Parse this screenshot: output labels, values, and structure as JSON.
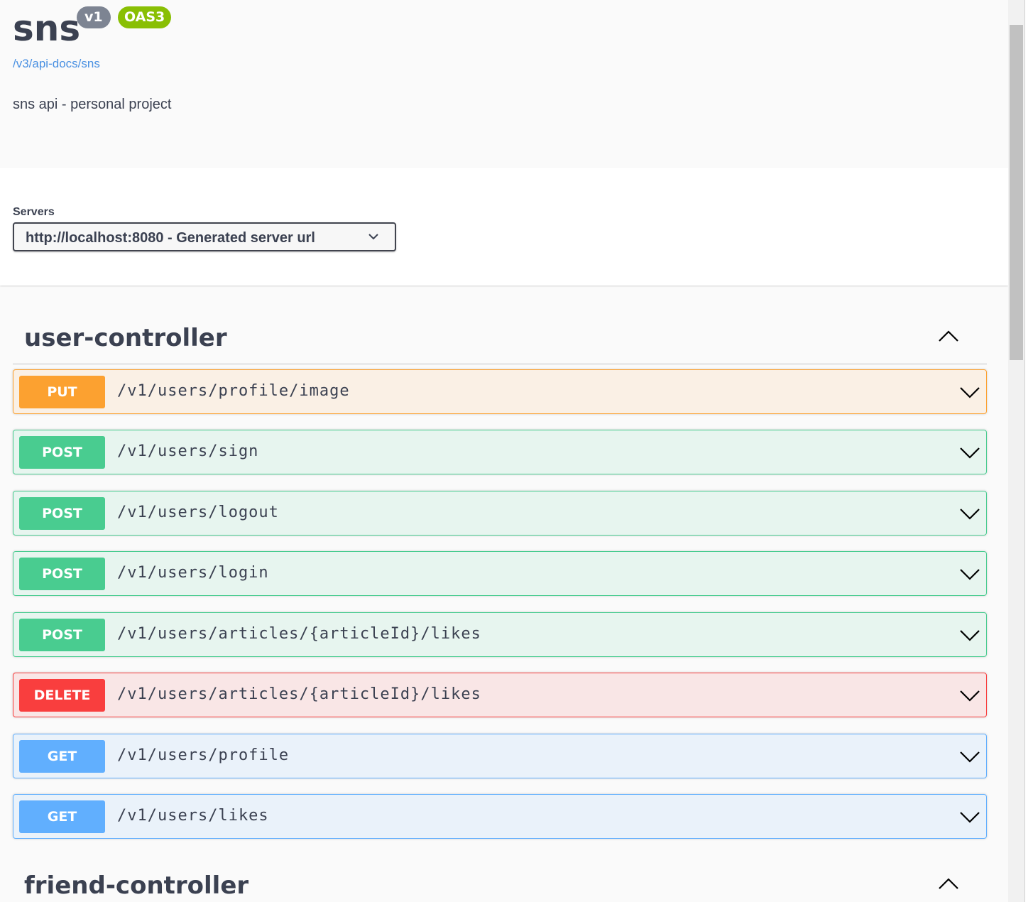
{
  "info": {
    "title": "sns",
    "version_badge": "v1",
    "oas_badge": "OAS3",
    "spec_link": "/v3/api-docs/sns",
    "description": "sns api - personal project"
  },
  "servers": {
    "label": "Servers",
    "selected": "http://localhost:8080 - Generated server url"
  },
  "tags": [
    {
      "name": "user-controller",
      "operations": [
        {
          "method": "PUT",
          "path": "/v1/users/profile/image"
        },
        {
          "method": "POST",
          "path": "/v1/users/sign"
        },
        {
          "method": "POST",
          "path": "/v1/users/logout"
        },
        {
          "method": "POST",
          "path": "/v1/users/login"
        },
        {
          "method": "POST",
          "path": "/v1/users/articles/{articleId}/likes"
        },
        {
          "method": "DELETE",
          "path": "/v1/users/articles/{articleId}/likes"
        },
        {
          "method": "GET",
          "path": "/v1/users/profile"
        },
        {
          "method": "GET",
          "path": "/v1/users/likes"
        }
      ]
    },
    {
      "name": "friend-controller",
      "operations": []
    }
  ],
  "colors": {
    "put": "#fca130",
    "post": "#49cc90",
    "delete": "#f93e3e",
    "get": "#61affe",
    "version_badge": "#7d8492",
    "oas_badge": "#89bf04",
    "link": "#4990e2"
  }
}
